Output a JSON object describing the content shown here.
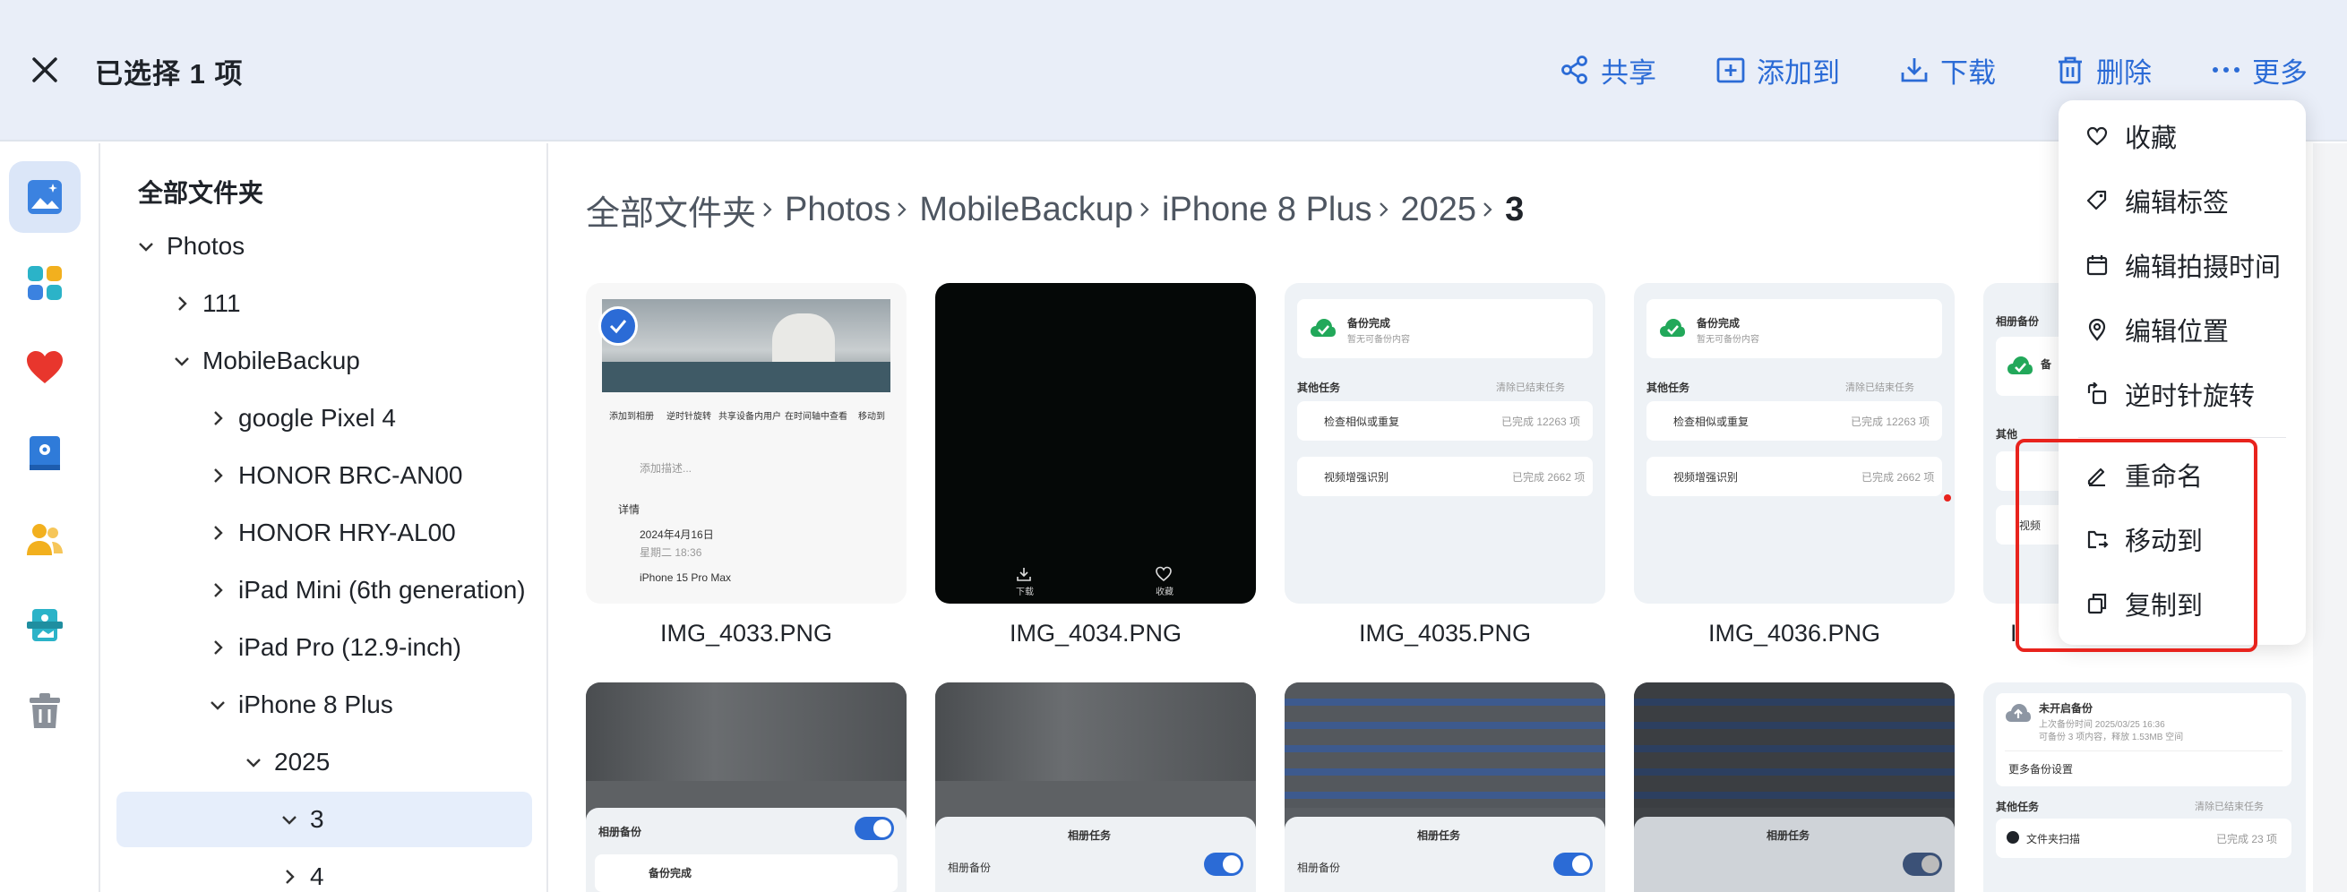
{
  "topbar": {
    "selection_text": "已选择 1 项",
    "actions": [
      {
        "label": "共享",
        "icon": "share-icon"
      },
      {
        "label": "添加到",
        "icon": "add-to-folder-icon"
      },
      {
        "label": "下载",
        "icon": "download-icon"
      },
      {
        "label": "删除",
        "icon": "trash-icon"
      },
      {
        "label": "更多",
        "icon": "more-dots-icon"
      }
    ]
  },
  "rail": [
    "photos-icon",
    "apps-icon",
    "favorites-heart-icon",
    "album-book-icon",
    "people-icon",
    "memories-icon",
    "recycle-bin-icon"
  ],
  "tree": {
    "root": "全部文件夹",
    "items": [
      {
        "label": "Photos",
        "expanded": true
      },
      {
        "label": "111",
        "expanded": false
      },
      {
        "label": "MobileBackup",
        "expanded": true
      },
      {
        "label": "google Pixel 4",
        "expanded": false
      },
      {
        "label": "HONOR BRC-AN00",
        "expanded": false
      },
      {
        "label": "HONOR HRY-AL00",
        "expanded": false
      },
      {
        "label": "iPad Mini (6th generation)",
        "expanded": false
      },
      {
        "label": "iPad Pro (12.9-inch)",
        "expanded": false
      },
      {
        "label": "iPhone 8 Plus",
        "expanded": true
      },
      {
        "label": "2025",
        "expanded": true
      },
      {
        "label": "3",
        "expanded": true,
        "selected": true
      },
      {
        "label": "4",
        "expanded": false
      }
    ]
  },
  "breadcrumb": [
    "全部文件夹",
    "Photos",
    "MobileBackup",
    "iPhone 8 Plus",
    "2025",
    "3"
  ],
  "files": [
    "IMG_4033.PNG",
    "IMG_4034.PNG",
    "IMG_4035.PNG",
    "IMG_4036.PNG",
    "I"
  ],
  "thumb_text": {
    "t1_actions": [
      "添加到相册",
      "逆时针旋转",
      "共享设备内用户",
      "在时间轴中查看",
      "移动到"
    ],
    "t1_add_desc": "添加描述...",
    "t1_details": "详情",
    "t1_date": "2024年4月16日",
    "t1_time": "星期二 18:36",
    "t1_device": "iPhone 15 Pro Max",
    "t2_download": "下载",
    "t2_fav": "收藏",
    "backup_done": "备份完成",
    "backup_sub": "暂无可备份内容",
    "other_tasks": "其他任务",
    "clear_done": "清除已结束任务",
    "check_similar": "检查相似或重复",
    "check_status": "已完成 12263 项",
    "video_enhance": "视频增强识别",
    "video_status": "已完成 2662 项",
    "album_backup": "相册备份",
    "album_tasks": "相册任务",
    "not_started": "未开启备份",
    "last_backup": "上次备份时间 2025/03/25 16:36",
    "can_backup": "可备份 3 项内容，释放 1.53MB 空间",
    "more_settings": "更多备份设置",
    "folder_scan": "文件夹扫描",
    "scan_status": "已完成 23 项",
    "partial_1": "备",
    "partial_2": "其他",
    "partial_3": "视频"
  },
  "menu": {
    "items": [
      "收藏",
      "编辑标签",
      "编辑拍摄时间",
      "编辑位置",
      "逆时针旋转",
      "重命名",
      "移动到",
      "复制到"
    ],
    "icons": [
      "heart-outline-icon",
      "tag-icon",
      "calendar-icon",
      "location-pin-icon",
      "rotate-ccw-icon",
      "rename-pencil-icon",
      "move-to-icon",
      "copy-icon"
    ]
  },
  "colors": {
    "accent": "#2b6bd6",
    "highlight": "#e8231d",
    "topbar_bg": "#e9eef8"
  }
}
